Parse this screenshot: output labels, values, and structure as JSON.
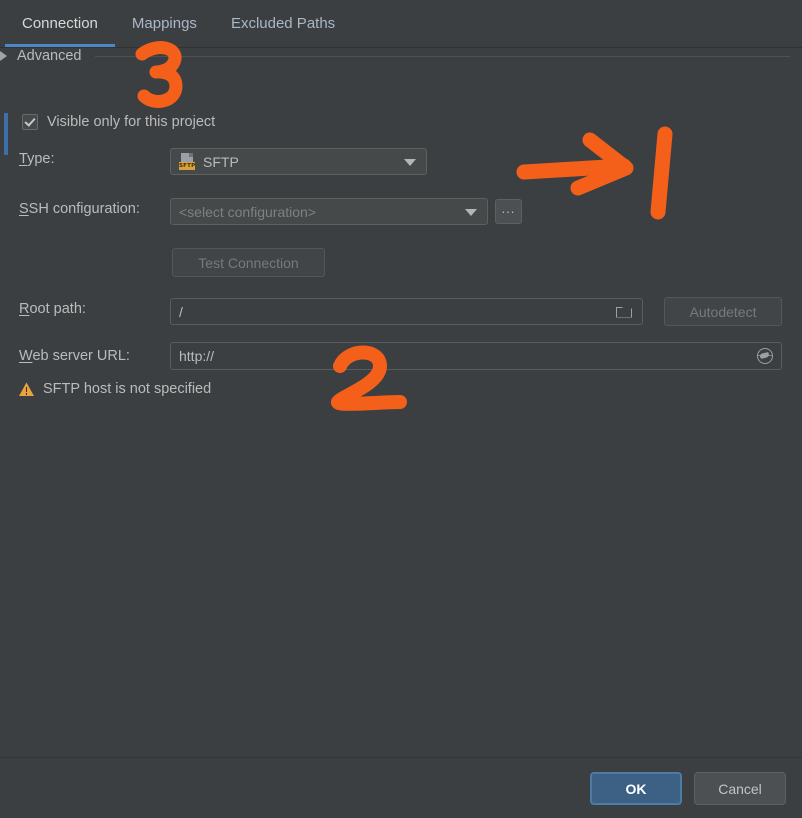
{
  "dialog": {
    "tabs": [
      {
        "label": "Connection",
        "active": true
      },
      {
        "label": "Mappings",
        "active": false
      },
      {
        "label": "Excluded Paths",
        "active": false
      }
    ],
    "visible_only_checkbox": {
      "label": "Visible only for this project",
      "checked": true
    },
    "fields": {
      "type": {
        "label": "Type:",
        "mnemonic": "T",
        "label_rest": "ype:",
        "value": "SFTP",
        "icon": "sftp-file-icon",
        "icon_badge": "SFTP"
      },
      "ssh_configuration": {
        "label": "SSH configuration:",
        "mnemonic": "S",
        "label_rest": "SH configuration:",
        "placeholder": "<select configuration>",
        "value": "",
        "browse_button_label": "...",
        "browse_icon": "ellipsis-icon"
      },
      "test_connection": {
        "label": "Test Connection",
        "enabled": false
      },
      "root_path": {
        "label": "Root path:",
        "mnemonic": "R",
        "label_rest": "oot path:",
        "value": "/",
        "icon": "folder-icon",
        "autodetect_label": "Autodetect",
        "autodetect_enabled": false
      },
      "web_server_url": {
        "label": "Web server URL:",
        "mnemonic": "W",
        "label_rest": "eb server URL:",
        "value": "http://",
        "icon": "globe-icon"
      }
    },
    "warning": {
      "icon": "warning-triangle-icon",
      "text": "SFTP host is not specified"
    },
    "advanced": {
      "label": "Advanced",
      "expanded": false,
      "icon": "chevron-right-icon"
    },
    "footer": {
      "ok_label": "OK",
      "cancel_label": "Cancel"
    }
  },
  "annotations": {
    "color": "#f4601a",
    "marks": [
      {
        "name": "annotation-number-3",
        "text": "3"
      },
      {
        "name": "annotation-arrow-right",
        "text": ""
      },
      {
        "name": "annotation-number-1",
        "text": "1"
      },
      {
        "name": "annotation-number-2",
        "text": "2"
      }
    ]
  },
  "colors": {
    "background": "#3c3f41",
    "accent_blue": "#4a88c7",
    "annotation_orange": "#f4601a",
    "warning_amber": "#e8a33d"
  }
}
